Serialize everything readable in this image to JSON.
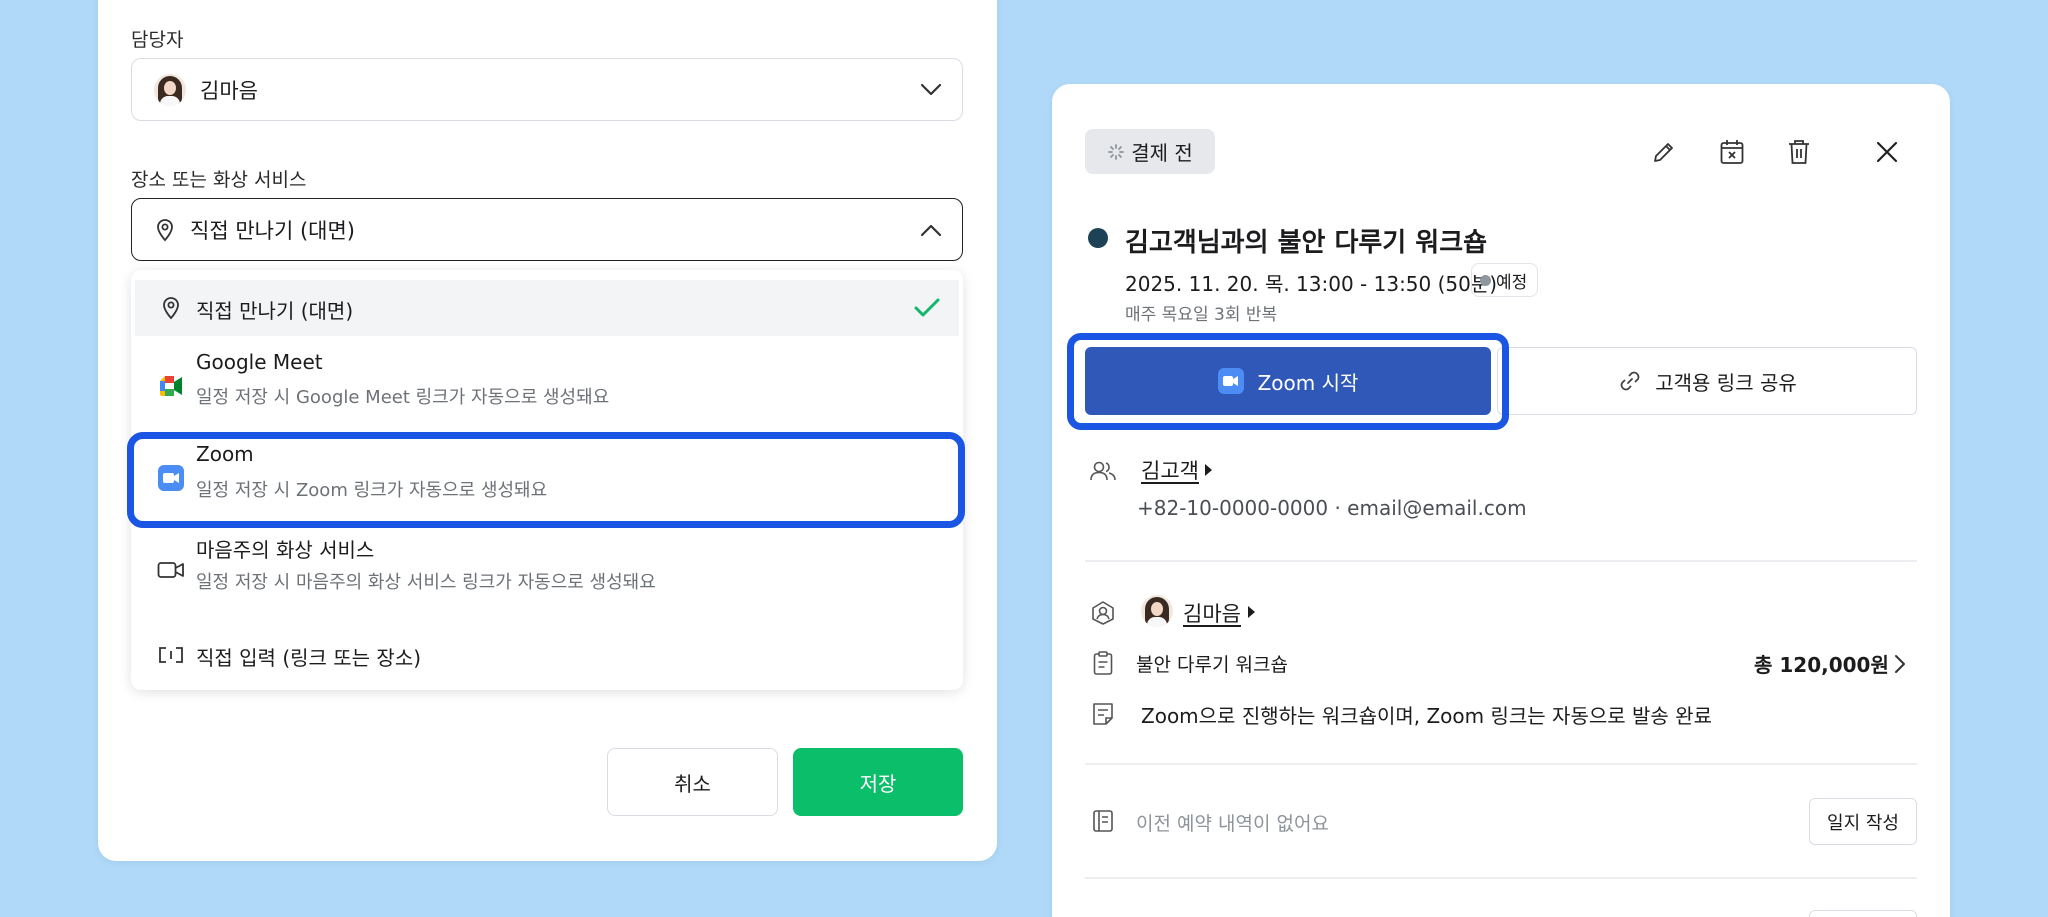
{
  "form": {
    "assignee_label": "담당자",
    "assignee_name": "김마음",
    "location_label": "장소 또는 화상 서비스",
    "location_selected": "직접 만나기 (대면)"
  },
  "dropdown": {
    "options": [
      {
        "label": "직접 만나기 (대면)",
        "sub": ""
      },
      {
        "label": "Google Meet",
        "sub": "일정 저장 시 Google Meet 링크가 자동으로 생성돼요"
      },
      {
        "label": "Zoom",
        "sub": "일정 저장 시 Zoom 링크가 자동으로 생성돼요"
      },
      {
        "label": "마음주의 화상 서비스",
        "sub": "일정 저장 시 마음주의 화상 서비스 링크가 자동으로 생성돼요"
      },
      {
        "label": "직접 입력 (링크 또는 장소)",
        "sub": ""
      }
    ]
  },
  "actions": {
    "cancel": "취소",
    "save": "저장"
  },
  "detail": {
    "status": "결제 전",
    "title": "김고객님과의 불안 다루기 워크숍",
    "datetime": "2025. 11. 20. 목. 13:00 - 13:50 (50분)",
    "badge": "예정",
    "repeat": "매주 목요일 3회 반복",
    "zoom_button": "Zoom 시작",
    "share_button": "고객용 링크 공유",
    "client_name": "김고객",
    "client_contact": "+82-10-0000-0000 · email@email.com",
    "counselor_name": "김마음",
    "program": "불안 다루기 워크숍",
    "price": "총 120,000원",
    "memo": "Zoom으로 진행하는 워크숍이며, Zoom 링크는 자동으로 발송 완료",
    "history_empty": "이전 예약 내역이 없어요",
    "journal_button": "일지 작성"
  },
  "colors": {
    "background": "#b0d9f9",
    "highlight": "#1a55e3",
    "save": "#0bbf6a",
    "zoom_button": "#2f58b8",
    "check": "#12b76a"
  },
  "icons": {
    "chevron_down": "chevron-down-icon",
    "chevron_up": "chevron-up-icon",
    "location": "location-pin-icon",
    "check": "check-icon",
    "google_meet": "google-meet-icon",
    "zoom": "zoom-icon",
    "video": "video-camera-icon",
    "custom": "custom-input-icon",
    "edit": "pencil-icon",
    "calendar_cancel": "calendar-x-icon",
    "trash": "trash-icon",
    "close": "close-icon",
    "link": "link-icon",
    "users": "users-icon",
    "counselor": "counselor-badge-icon",
    "program": "clipboard-icon",
    "memo": "memo-icon",
    "history": "history-icon"
  }
}
